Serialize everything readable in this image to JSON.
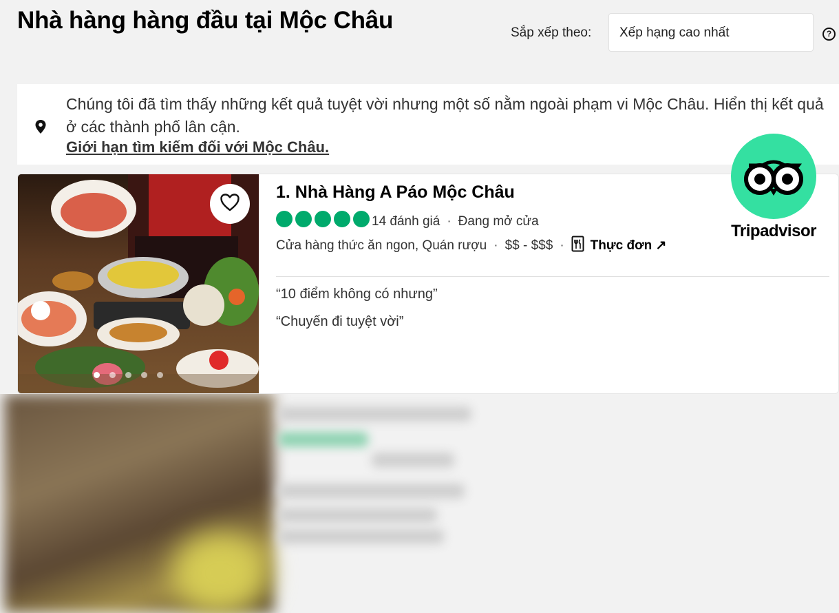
{
  "header": {
    "title": "Nhà hàng hàng đầu tại Mộc Châu",
    "sort_label": "Sắp xếp theo:",
    "sort_value": "Xếp hạng cao nhất",
    "help_glyph": "?"
  },
  "notice": {
    "text": "Chúng tôi đã tìm thấy những kết quả tuyệt vời nhưng một số nằm ngoài phạm vi Mộc Châu. Hiển thị kết quả ở các thành phố lân cận.",
    "link": "Giới hạn tìm kiếm đối với Mộc Châu."
  },
  "listing": {
    "name": "1. Nhà Hàng A Páo Mộc Châu",
    "rating_bubbles": 5,
    "review_count": "14 đánh giá",
    "status": "Đang mở cửa",
    "cuisines": "Cửa hàng thức ăn ngon, Quán rượu",
    "price": "$$ - $$$",
    "menu_label": "Thực đơn",
    "menu_arrow": "↗",
    "separator": "·",
    "reviews": [
      "“10 điểm không có nhưng”",
      "“Chuyến đi tuyệt vời”"
    ],
    "photo_count": 5,
    "active_photo": 1
  },
  "logo": {
    "text": "Tripadvisor"
  },
  "icons": {
    "pin": "location-pin-icon",
    "heart": "heart-icon",
    "menu": "menu-book-icon",
    "help": "help-icon"
  },
  "colors": {
    "rating_green": "#00aa6c",
    "logo_green": "#34e0a1",
    "background": "#f2f2f2"
  }
}
